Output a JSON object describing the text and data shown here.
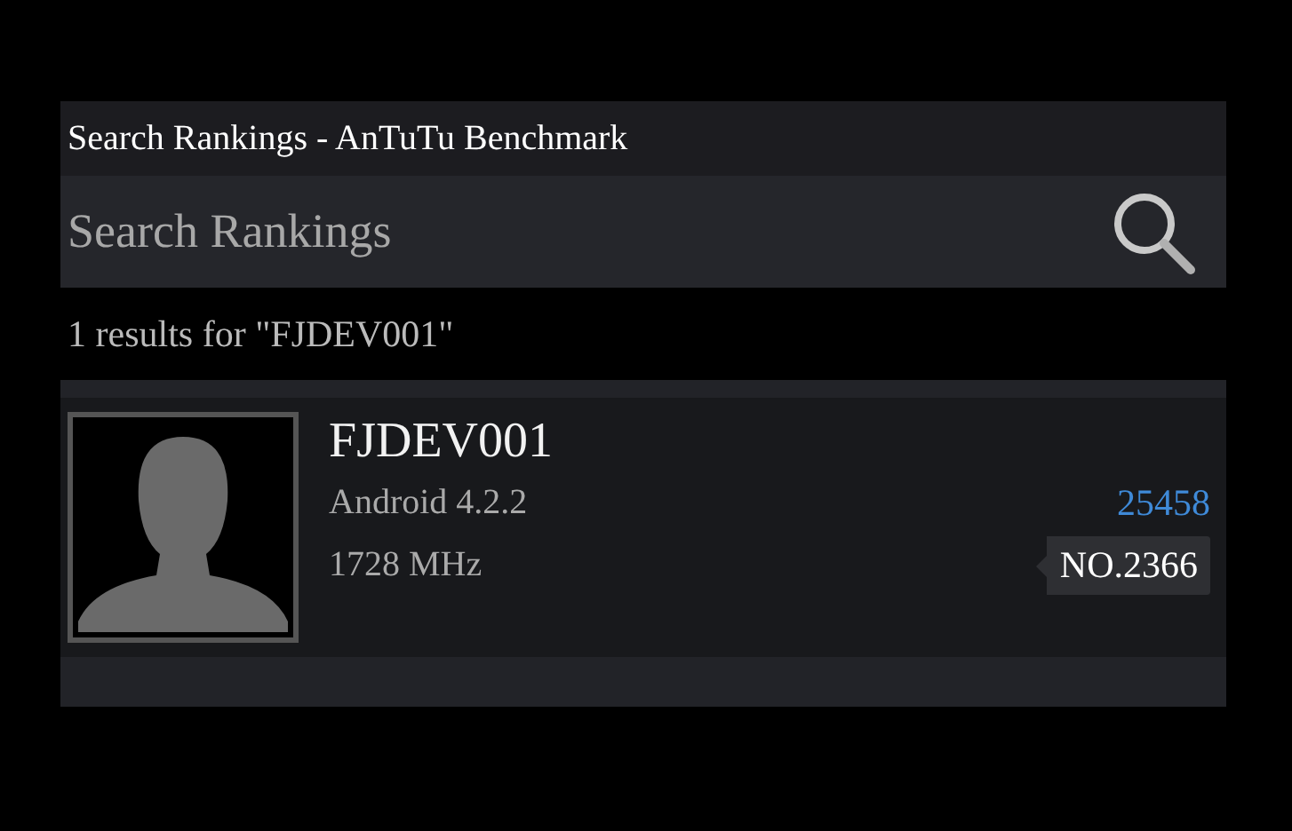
{
  "window": {
    "title": "Search Rankings - AnTuTu Benchmark"
  },
  "search": {
    "placeholder": "Search Rankings"
  },
  "results_summary": "1 results for \"FJDEV001\"",
  "results": [
    {
      "device": "FJDEV001",
      "os": "Android 4.2.2",
      "cpu": "1728 MHz",
      "score": "25458",
      "rank": "NO.2366"
    }
  ]
}
